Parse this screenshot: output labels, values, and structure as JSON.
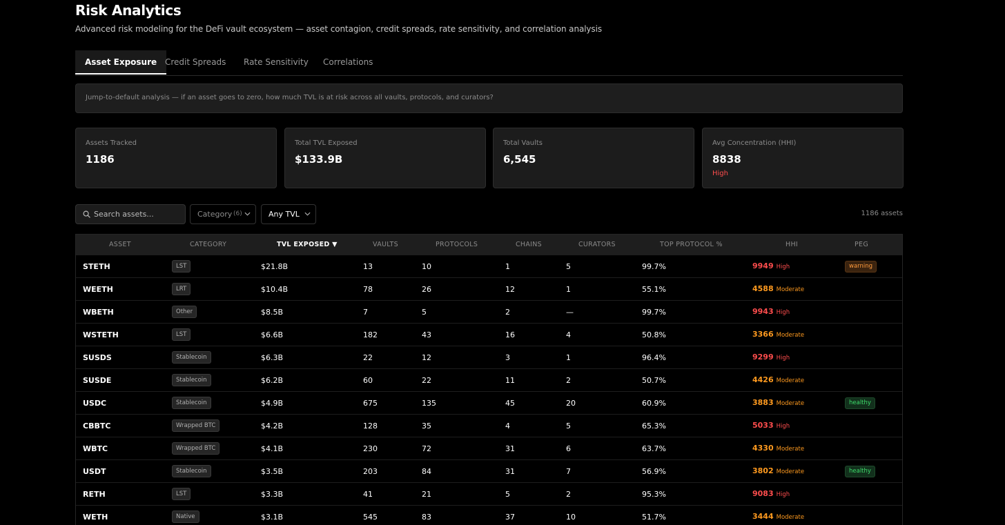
{
  "header": {
    "title": "Risk Analytics",
    "subtitle": "Advanced risk modeling for the DeFi vault ecosystem — asset contagion, credit spreads, rate sensitivity, and correlation analysis"
  },
  "tabs": [
    {
      "label": "Asset Exposure",
      "active": true
    },
    {
      "label": "Credit Spreads",
      "active": false
    },
    {
      "label": "Rate Sensitivity",
      "active": false
    },
    {
      "label": "Correlations",
      "active": false
    }
  ],
  "info_banner": "Jump-to-default analysis — if an asset goes to zero, how much TVL is at risk across all vaults, protocols, and curators?",
  "stats": [
    {
      "label": "Assets Tracked",
      "value": "1186",
      "note": ""
    },
    {
      "label": "Total TVL Exposed",
      "value": "$133.9B",
      "note": ""
    },
    {
      "label": "Total Vaults",
      "value": "6,545",
      "note": ""
    },
    {
      "label": "Avg Concentration (HHI)",
      "value": "8838",
      "note": "High"
    }
  ],
  "filters": {
    "search_placeholder": "Search assets...",
    "category_label": "Category",
    "category_count": "(6)",
    "tvl_label": "Any TVL",
    "asset_count": "1186 assets"
  },
  "table": {
    "columns": [
      "ASSET",
      "CATEGORY",
      "TVL EXPOSED ▼",
      "VAULTS",
      "PROTOCOLS",
      "CHAINS",
      "CURATORS",
      "TOP PROTOCOL %",
      "HHI",
      "PEG"
    ],
    "rows": [
      {
        "asset": "STETH",
        "category": "LST",
        "tvl": "$21.8B",
        "vaults": "13",
        "protocols": "10",
        "chains": "1",
        "curators": "5",
        "top_protocol": "99.7%",
        "hhi": "9949",
        "hhi_level": "High",
        "peg": "warning"
      },
      {
        "asset": "WEETH",
        "category": "LRT",
        "tvl": "$10.4B",
        "vaults": "78",
        "protocols": "26",
        "chains": "12",
        "curators": "1",
        "top_protocol": "55.1%",
        "hhi": "4588",
        "hhi_level": "Moderate",
        "peg": ""
      },
      {
        "asset": "WBETH",
        "category": "Other",
        "tvl": "$8.5B",
        "vaults": "7",
        "protocols": "5",
        "chains": "2",
        "curators": "—",
        "top_protocol": "99.7%",
        "hhi": "9943",
        "hhi_level": "High",
        "peg": ""
      },
      {
        "asset": "WSTETH",
        "category": "LST",
        "tvl": "$6.6B",
        "vaults": "182",
        "protocols": "43",
        "chains": "16",
        "curators": "4",
        "top_protocol": "50.8%",
        "hhi": "3366",
        "hhi_level": "Moderate",
        "peg": ""
      },
      {
        "asset": "SUSDS",
        "category": "Stablecoin",
        "tvl": "$6.3B",
        "vaults": "22",
        "protocols": "12",
        "chains": "3",
        "curators": "1",
        "top_protocol": "96.4%",
        "hhi": "9299",
        "hhi_level": "High",
        "peg": ""
      },
      {
        "asset": "SUSDE",
        "category": "Stablecoin",
        "tvl": "$6.2B",
        "vaults": "60",
        "protocols": "22",
        "chains": "11",
        "curators": "2",
        "top_protocol": "50.7%",
        "hhi": "4426",
        "hhi_level": "Moderate",
        "peg": ""
      },
      {
        "asset": "USDC",
        "category": "Stablecoin",
        "tvl": "$4.9B",
        "vaults": "675",
        "protocols": "135",
        "chains": "45",
        "curators": "20",
        "top_protocol": "60.9%",
        "hhi": "3883",
        "hhi_level": "Moderate",
        "peg": "healthy"
      },
      {
        "asset": "CBBTC",
        "category": "Wrapped BTC",
        "tvl": "$4.2B",
        "vaults": "128",
        "protocols": "35",
        "chains": "4",
        "curators": "5",
        "top_protocol": "65.3%",
        "hhi": "5033",
        "hhi_level": "High",
        "peg": ""
      },
      {
        "asset": "WBTC",
        "category": "Wrapped BTC",
        "tvl": "$4.1B",
        "vaults": "230",
        "protocols": "72",
        "chains": "31",
        "curators": "6",
        "top_protocol": "63.7%",
        "hhi": "4330",
        "hhi_level": "Moderate",
        "peg": ""
      },
      {
        "asset": "USDT",
        "category": "Stablecoin",
        "tvl": "$3.5B",
        "vaults": "203",
        "protocols": "84",
        "chains": "31",
        "curators": "7",
        "top_protocol": "56.9%",
        "hhi": "3802",
        "hhi_level": "Moderate",
        "peg": "healthy"
      },
      {
        "asset": "RETH",
        "category": "LST",
        "tvl": "$3.3B",
        "vaults": "41",
        "protocols": "21",
        "chains": "5",
        "curators": "2",
        "top_protocol": "95.3%",
        "hhi": "9083",
        "hhi_level": "High",
        "peg": ""
      },
      {
        "asset": "WETH",
        "category": "Native",
        "tvl": "$3.1B",
        "vaults": "545",
        "protocols": "83",
        "chains": "37",
        "curators": "10",
        "top_protocol": "51.7%",
        "hhi": "3444",
        "hhi_level": "Moderate",
        "peg": ""
      }
    ]
  },
  "colors": {
    "high": "#ff4d4d",
    "moderate": "#ff9a1f",
    "warning_text": "#ff9a3c",
    "warning_bg": "#3a230f",
    "healthy_text": "#3ddc6a",
    "healthy_bg": "#12301c"
  }
}
